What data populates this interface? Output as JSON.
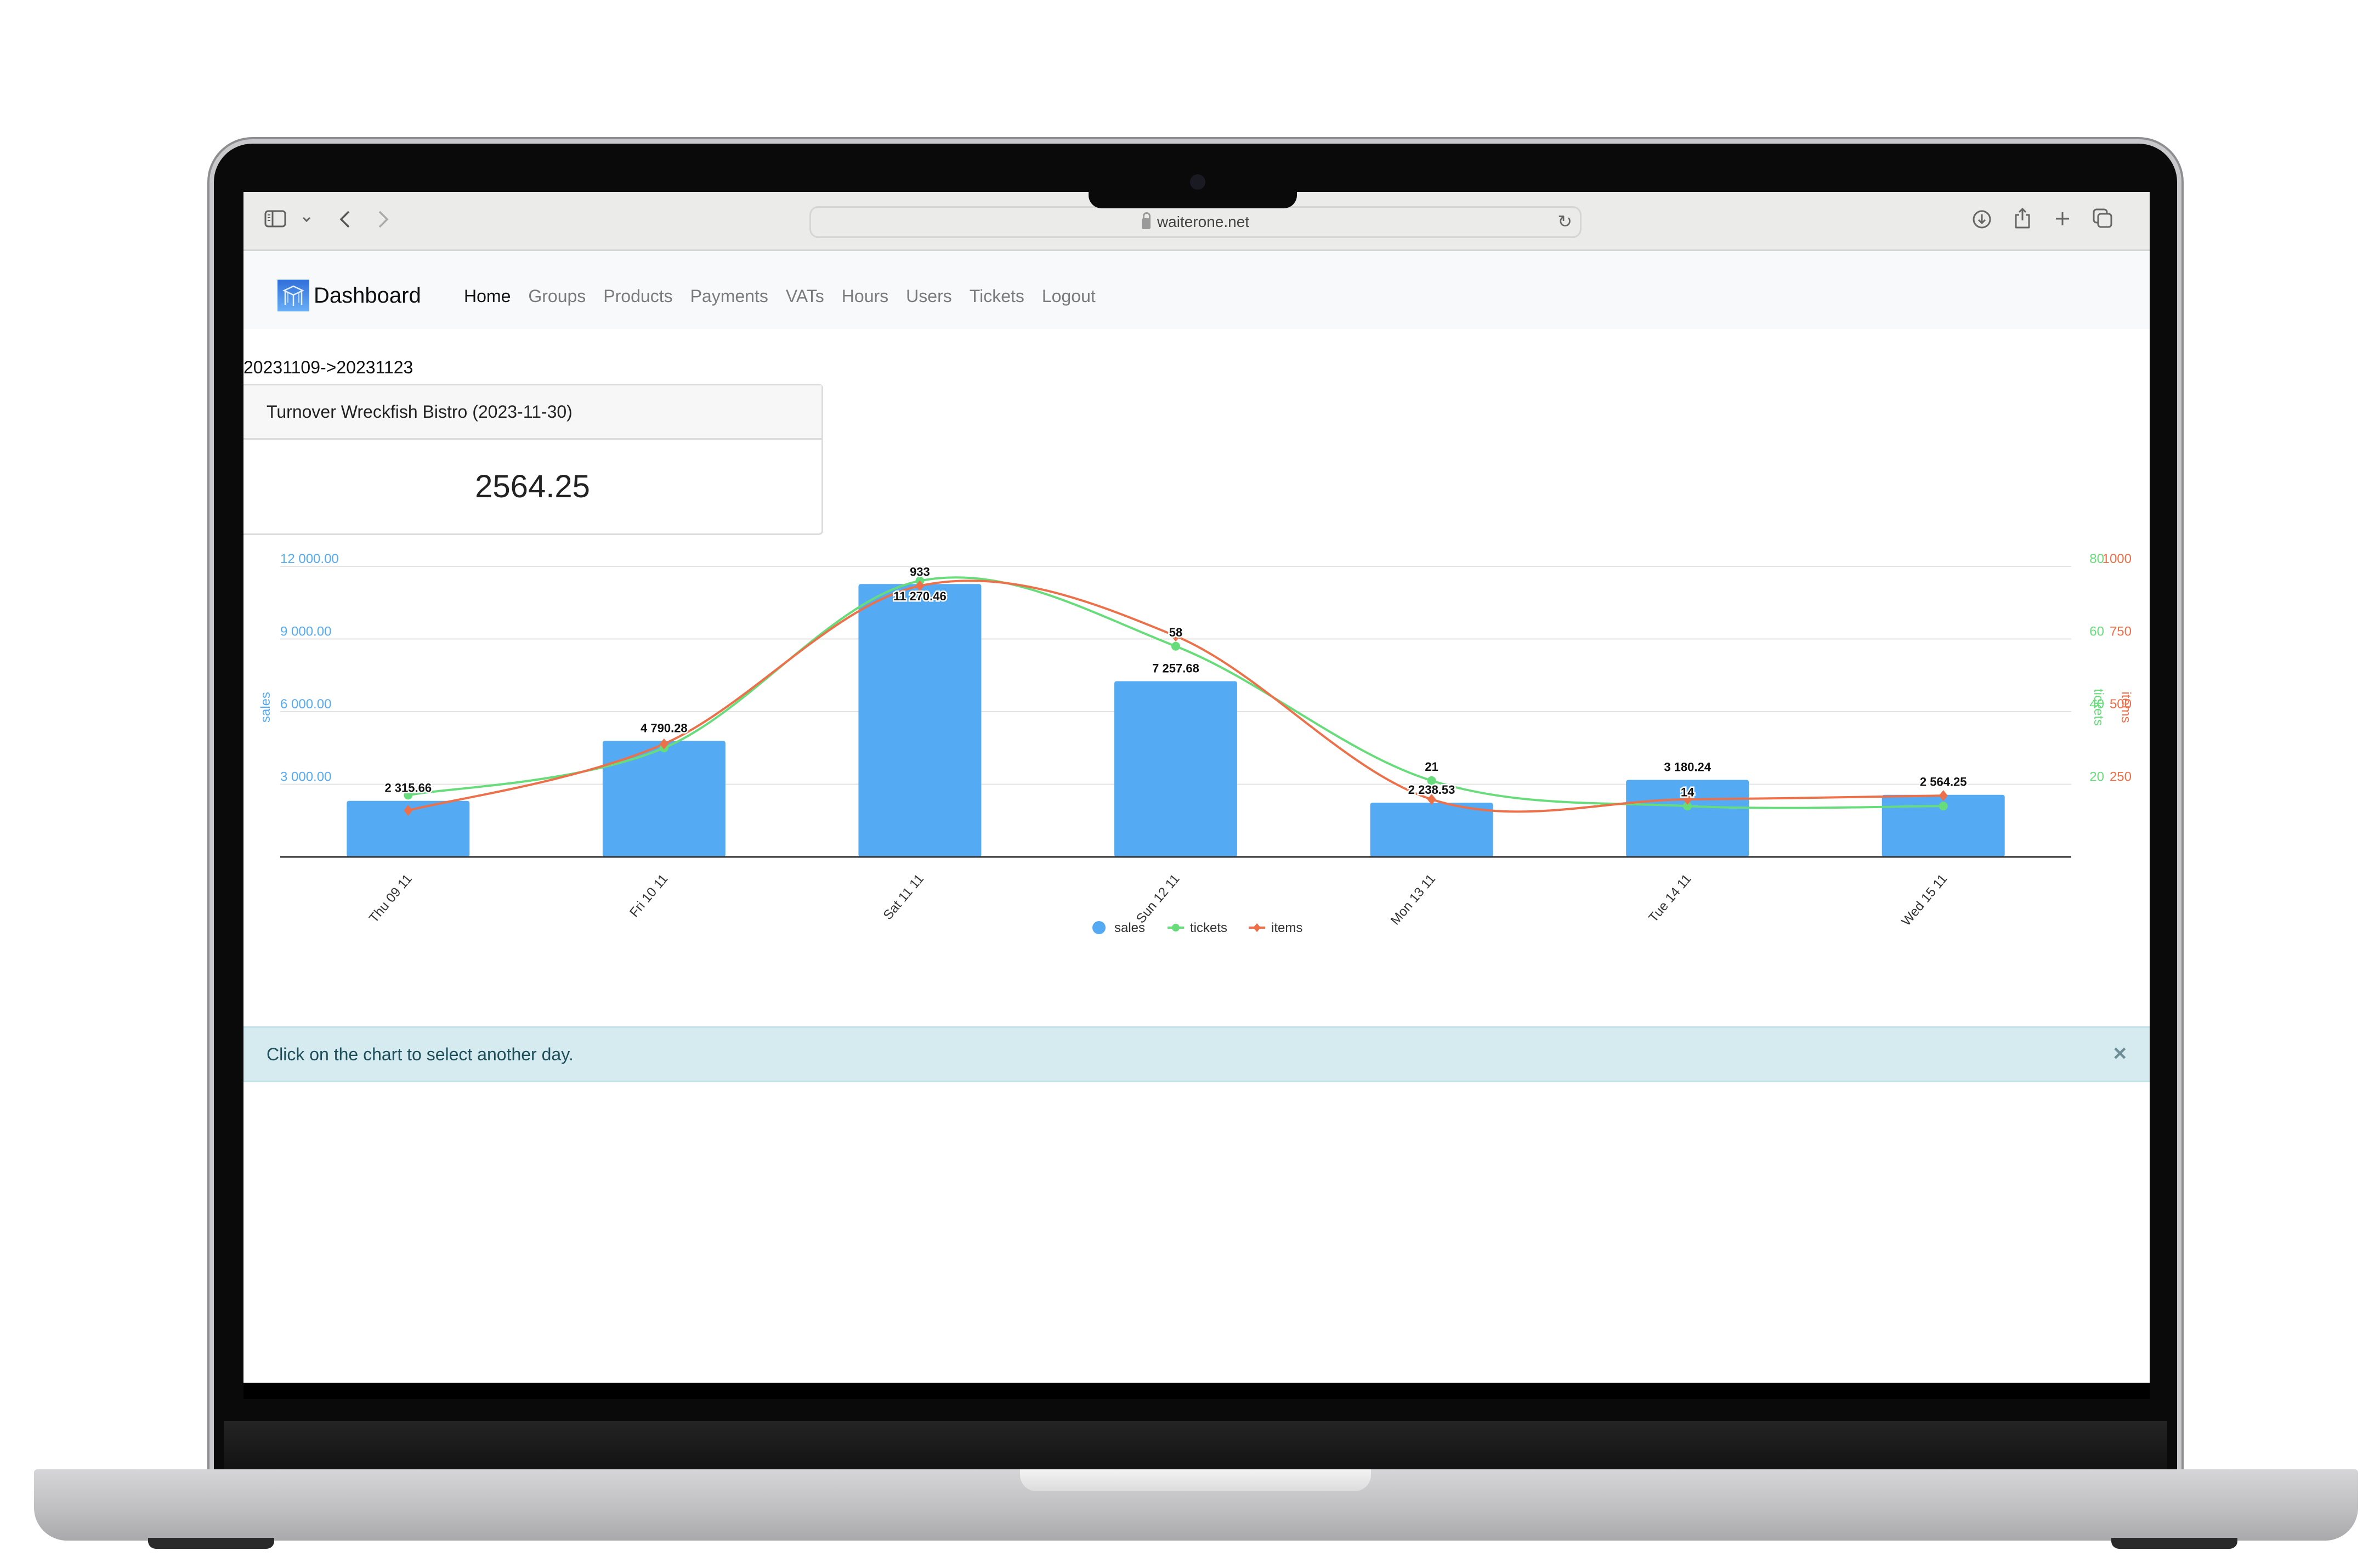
{
  "browser": {
    "url": "waiterone.net",
    "icons": [
      "sidebar-icon",
      "chevron-down-icon",
      "back-icon",
      "forward-icon",
      "reload-icon",
      "download-icon",
      "share-icon",
      "new-tab-icon",
      "tabs-overview-icon"
    ]
  },
  "navbar": {
    "brand": "Dashboard",
    "links": [
      {
        "label": "Home",
        "active": true
      },
      {
        "label": "Groups"
      },
      {
        "label": "Products"
      },
      {
        "label": "Payments"
      },
      {
        "label": "VATs"
      },
      {
        "label": "Hours"
      },
      {
        "label": "Users"
      },
      {
        "label": "Tickets"
      },
      {
        "label": "Logout"
      }
    ]
  },
  "main": {
    "date_range": "20231109->20231123",
    "card": {
      "header": "Turnover Wreckfish Bistro (2023-11-30)",
      "value": "2564.25"
    },
    "alert": {
      "text": "Click on the chart to select another day.",
      "close": "×"
    }
  },
  "colors": {
    "sales": "#55aaf4",
    "tickets": "#67dc7a",
    "items": "#ec7049",
    "alert_bg": "#d5ebf0"
  },
  "chart_data": {
    "type": "bar",
    "categories": [
      "Thu 09 11",
      "Fri 10 11",
      "Sat 11 11",
      "Sun 12 11",
      "Mon 13 11",
      "Tue 14 11",
      "Wed 15 11"
    ],
    "series": [
      {
        "name": "sales",
        "type": "bar",
        "axis": "left",
        "values": [
          2315.66,
          4790.28,
          11270.46,
          7257.68,
          2238.53,
          3180.24,
          2564.25
        ],
        "labels": [
          "2 315.66",
          "4 790.28",
          "11 270.46",
          "7 257.68",
          "2 238.53",
          "3 180.24",
          "2 564.25"
        ]
      },
      {
        "name": "tickets",
        "type": "line",
        "smooth": true,
        "axis": "right1",
        "values": [
          17,
          30,
          76,
          58,
          21,
          14,
          14
        ],
        "labels": [
          "",
          "",
          "",
          "58",
          "21",
          "14",
          ""
        ]
      },
      {
        "name": "items",
        "type": "line",
        "smooth": true,
        "axis": "right2",
        "values": [
          160,
          389,
          933,
          760,
          198,
          198,
          211
        ],
        "labels": [
          "",
          "",
          "933",
          "",
          "",
          "",
          ""
        ]
      }
    ],
    "axes": {
      "left": {
        "label": "sales",
        "range": [
          0,
          12000
        ],
        "ticks": [
          "3 000.00",
          "6 000.00",
          "9 000.00",
          "12 000.00"
        ]
      },
      "right1": {
        "label": "tickets",
        "range": [
          0,
          80
        ],
        "ticks": [
          "20",
          "40",
          "60",
          "80"
        ]
      },
      "right2": {
        "label": "items",
        "range": [
          0,
          1000
        ],
        "ticks": [
          "250",
          "500",
          "750",
          "1000"
        ]
      }
    },
    "legend": {
      "position": "bottom",
      "items": [
        "sales",
        "tickets",
        "items"
      ]
    },
    "grid": true
  }
}
